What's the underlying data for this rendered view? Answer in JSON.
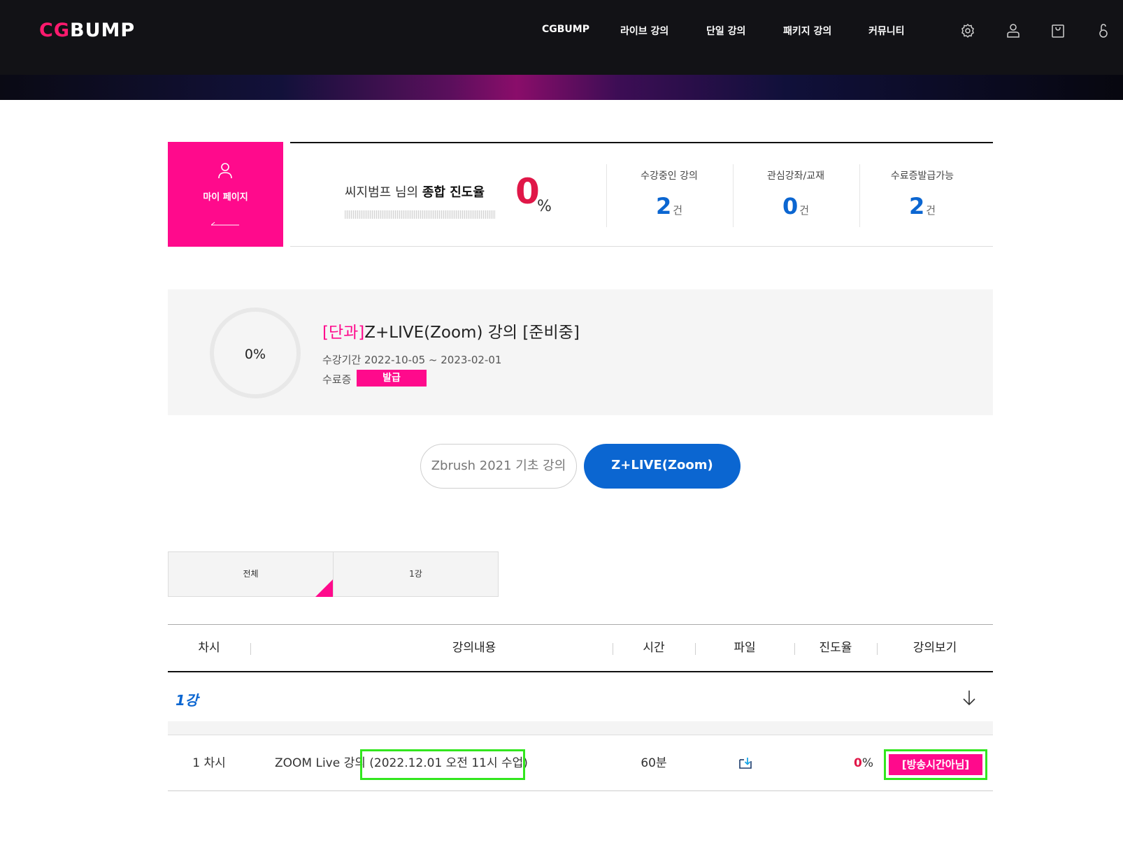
{
  "header": {
    "logo_cg": "CG",
    "logo_bump": "BUMP",
    "nav": [
      "CGBUMP",
      "라이브 강의",
      "단일 강의",
      "패키지 강의",
      "커뮤니티"
    ],
    "icons": [
      "settings-icon",
      "user-icon",
      "cart-icon",
      "lock-icon"
    ]
  },
  "mypage": {
    "label": "마이 페이지"
  },
  "summary": {
    "owner_prefix": "씨지범프 님의 ",
    "owner_bold": "종합 진도율",
    "total_progress": "0",
    "total_progress_unit": "%",
    "stats": [
      {
        "title": "수강중인 강의",
        "value": "2",
        "unit": "건"
      },
      {
        "title": "관심강좌/교재",
        "value": "0",
        "unit": "건"
      },
      {
        "title": "수료증발급가능",
        "value": "2",
        "unit": "건"
      }
    ]
  },
  "course": {
    "progress": "0%",
    "category": "[단과]",
    "title": "Z+LIVE(Zoom) 강의 [준비중]",
    "period": "수강기간 2022-10-05 ~ 2023-02-01",
    "cert_label": "수료증",
    "cert_button": "발급"
  },
  "course_tabs": [
    "Zbrush 2021 기초 강의",
    "Z+LIVE(Zoom)"
  ],
  "chapter_tabs": [
    "전체",
    "1강"
  ],
  "table": {
    "headers": [
      "차시",
      "강의내용",
      "시간",
      "파일",
      "진도율",
      "강의보기"
    ],
    "chapter": "1강",
    "rows": [
      {
        "session": "1 차시",
        "content_prefix": "ZOOM Live 강의",
        "content_highlight": "(2022.12.01 오전 11시 수업)",
        "time": "60분",
        "progress_value": "0",
        "progress_unit": "%",
        "view_button": "[방송시간아님]"
      }
    ]
  },
  "colors": {
    "brand_pink": "#ff0a8c",
    "brand_blue": "#0b66d1",
    "highlight_green": "#32e61e"
  }
}
